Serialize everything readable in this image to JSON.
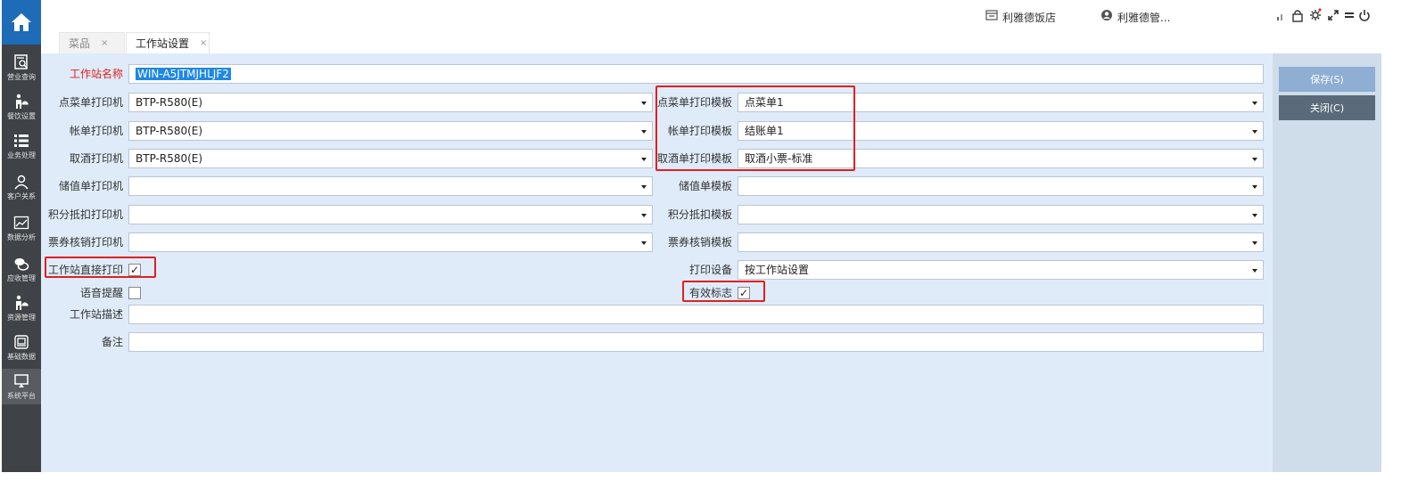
{
  "sidebar": {
    "items": [
      {
        "label": "营业查询",
        "icon": "search-receipt-icon"
      },
      {
        "label": "餐饮设置",
        "icon": "waiter-icon"
      },
      {
        "label": "业务处理",
        "icon": "list-icon"
      },
      {
        "label": "客户关系",
        "icon": "users-icon"
      },
      {
        "label": "数据分析",
        "icon": "chart-icon"
      },
      {
        "label": "应收管理",
        "icon": "money-icon"
      },
      {
        "label": "资源管理",
        "icon": "waiter-icon"
      },
      {
        "label": "基础数据",
        "icon": "printer-icon"
      },
      {
        "label": "系统平台",
        "icon": "monitor-icon"
      }
    ]
  },
  "topbar": {
    "store": "利雅德饭店",
    "user": "利雅德管..."
  },
  "tabs": [
    {
      "label": "菜品",
      "close": "×"
    },
    {
      "label": "工作站设置",
      "close": "×"
    }
  ],
  "form": {
    "station_name_label": "工作站名称",
    "station_name_value": "WIN-A5JTMJHLJF2",
    "order_printer_label": "点菜单打印机",
    "order_printer_value": "BTP-R580(E)",
    "bill_printer_label": "帐单打印机",
    "bill_printer_value": "BTP-R580(E)",
    "cancel_printer_label": "取酒打印机",
    "cancel_printer_value": "BTP-R580(E)",
    "stored_printer_label": "储值单打印机",
    "stored_printer_value": "",
    "points_printer_label": "积分抵扣打印机",
    "points_printer_value": "",
    "coupon_printer_label": "票券核销打印机",
    "coupon_printer_value": "",
    "direct_print_label": "工作站直接打印",
    "direct_print_checked": "✓",
    "voice_label": "语音提醒",
    "voice_checked": "",
    "desc_label": "工作站描述",
    "desc_value": "",
    "remark_label": "备注",
    "remark_value": "",
    "order_tpl_label": "点菜单打印模板",
    "order_tpl_value": "点菜单1",
    "bill_tpl_label": "帐单打印模板",
    "bill_tpl_value": "结账单1",
    "cancel_tpl_label": "取酒单打印模板",
    "cancel_tpl_value": "取酒小票-标准",
    "stored_tpl_label": "储值单模板",
    "stored_tpl_value": "",
    "points_tpl_label": "积分抵扣模板",
    "points_tpl_value": "",
    "coupon_tpl_label": "票券核销模板",
    "coupon_tpl_value": "",
    "device_label": "打印设备",
    "device_value": "按工作站设置",
    "valid_label": "有效标志",
    "valid_checked": "✓"
  },
  "buttons": {
    "save": "保存(S)",
    "close": "关闭(C)"
  },
  "colors": {
    "sidebar": "#3f4347",
    "home": "#1e6bb8",
    "content": "#dfebf8",
    "panel": "#cfdcea",
    "save_btn": "#8eaed3",
    "close_btn": "#5a6a7a",
    "required": "#e02020",
    "highlight": "#e02020"
  }
}
